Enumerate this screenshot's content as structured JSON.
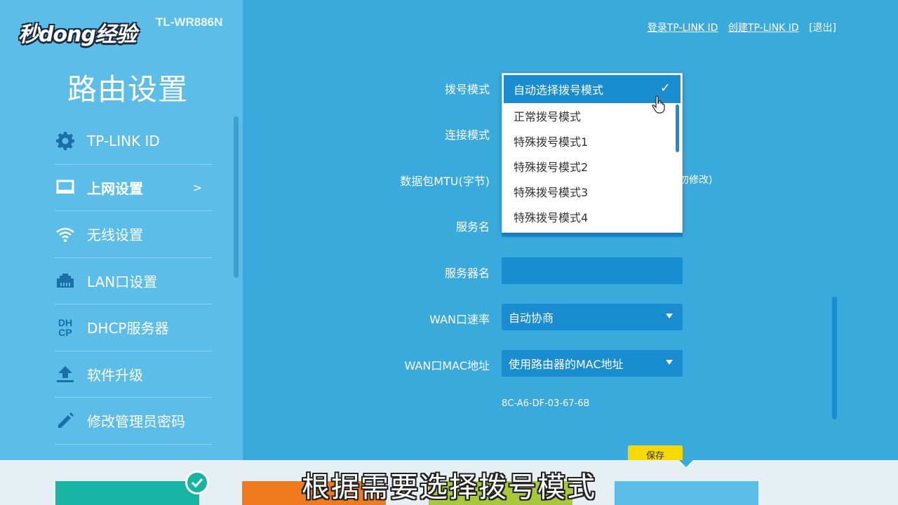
{
  "brand": {
    "model": "TL-WR886N"
  },
  "watermark": {
    "text": "秒dong经验"
  },
  "sidebar": {
    "title": "路由设置",
    "items": [
      {
        "label": "TP-LINK ID",
        "icon": "gear-icon"
      },
      {
        "label": "上网设置",
        "icon": "monitor-icon",
        "arrow": ">"
      },
      {
        "label": "无线设置",
        "icon": "wifi-icon"
      },
      {
        "label": "LAN口设置",
        "icon": "lan-port-icon"
      },
      {
        "label": "DHCP服务器",
        "icon": "dhcp-icon",
        "icon_text": "DH\nCP"
      },
      {
        "label": "软件升级",
        "icon": "upload-icon"
      },
      {
        "label": "修改管理员密码",
        "icon": "pencil-icon"
      }
    ]
  },
  "toplinks": {
    "login": "登录TP-LINK ID",
    "create": "创建TP-LINK ID",
    "logout": "[退出]"
  },
  "form": {
    "dial_mode_label": "拨号模式",
    "connect_mode_label": "连接模式",
    "mtu_label": "数据包MTU(字节)",
    "mtu_hint": "勿修改)",
    "service_name_label": "服务名",
    "server_name_label": "服务器名",
    "server_name_value": "",
    "wan_speed_label": "WAN口速率",
    "wan_speed_value": "自动协商",
    "wan_mac_label": "WAN口MAC地址",
    "wan_mac_value": "使用路由器的MAC地址",
    "mac_address": "8C-A6-DF-03-67-6B"
  },
  "dropdown": {
    "selected": "自动选择拨号模式",
    "options": [
      "正常拨号模式",
      "特殊拨号模式1",
      "特殊拨号模式2",
      "特殊拨号模式3",
      "特殊拨号模式4"
    ]
  },
  "save_label": "保存",
  "subtitle": "根据需要选择拨号模式",
  "colors": {
    "main_bg": "#3aa9dc",
    "sidebar_bg": "#5cbde8",
    "field_bg": "#1a8dd0",
    "save_yellow": "#f6d900",
    "tile_teal": "#17b3a3",
    "tile_orange": "#f07b1e",
    "tile_green": "#a7c83a"
  }
}
